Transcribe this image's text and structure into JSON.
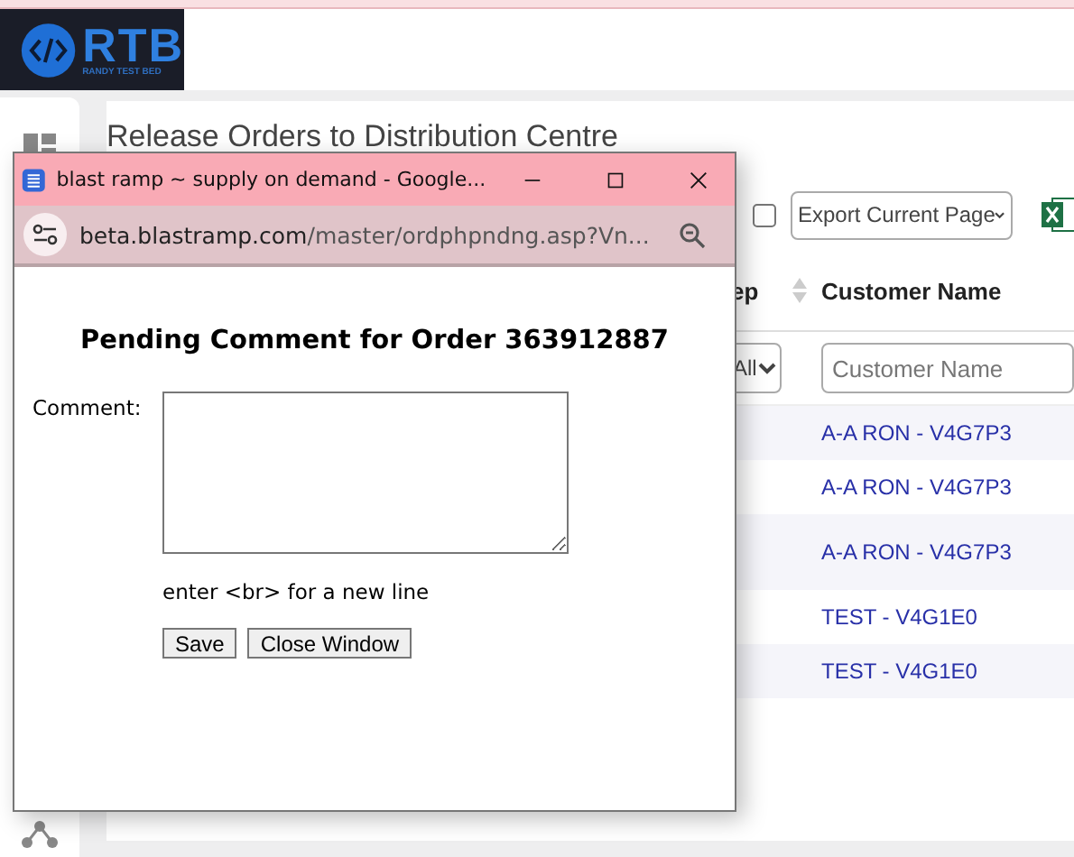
{
  "logo": {
    "name": "RTB",
    "tagline": "RANDY TEST BED"
  },
  "page": {
    "title": "Release Orders to Distribution Centre"
  },
  "toolbar": {
    "select_all_checked": false,
    "export_select": "Export Current Page"
  },
  "table": {
    "columns": [
      "ep",
      "Customer Name"
    ],
    "filters": [
      {
        "kind": "select",
        "value": "All"
      },
      {
        "kind": "input",
        "placeholder": "Customer Name"
      }
    ],
    "rows": [
      {
        "customer": "A-A RON - V4G7P3"
      },
      {
        "customer": "A-A RON - V4G7P3"
      },
      {
        "customer": "A-A RON - V4G7P3"
      },
      {
        "customer": "TEST - V4G1E0"
      },
      {
        "customer": "TEST - V4G1E0"
      }
    ]
  },
  "popup": {
    "title": "blast ramp ~ supply on demand - Google...",
    "url_host": "beta.blastramp.com",
    "url_path": "/master/ordphpndng.asp?Vn...",
    "heading": "Pending Comment for Order 363912887",
    "comment_label": "Comment:",
    "hint": "enter <br> for a new line",
    "buttons": [
      "Save",
      "Close Window"
    ]
  }
}
